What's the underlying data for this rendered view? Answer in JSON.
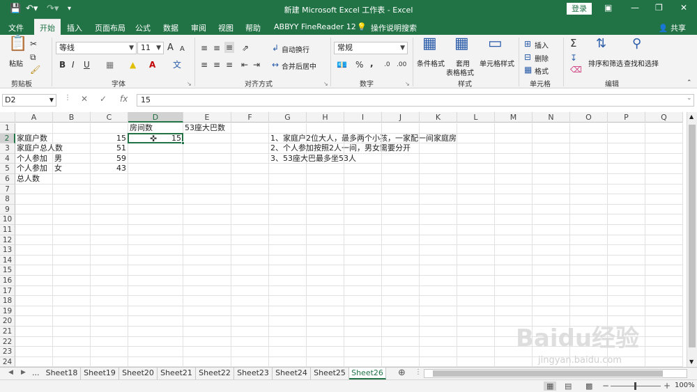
{
  "title": "新建 Microsoft Excel 工作表 - Excel",
  "login_label": "登录",
  "quick_access": {
    "save_icon": "save-icon",
    "undo_icon": "undo-icon",
    "redo_icon": "redo-icon",
    "customize_icon": "customize-icon"
  },
  "tabs": [
    "文件",
    "开始",
    "插入",
    "页面布局",
    "公式",
    "数据",
    "审阅",
    "视图",
    "帮助",
    "ABBYY FineReader 12"
  ],
  "tell_me": "操作说明搜索",
  "share": "共享",
  "ribbon": {
    "clipboard": {
      "paste": "粘贴",
      "group": "剪贴板"
    },
    "font": {
      "name": "等线",
      "size": "11",
      "group": "字体",
      "bold": "B",
      "italic": "I",
      "underline": "U",
      "grow": "A",
      "shrink": "A"
    },
    "alignment": {
      "wrap": "自动换行",
      "merge": "合并后居中",
      "group": "对齐方式"
    },
    "number": {
      "format": "常规",
      "percent": "%",
      "comma": ",",
      "group": "数字"
    },
    "styles": {
      "conditional": "条件格式",
      "table": "套用\n表格格式",
      "cell_styles": "单元格样式",
      "table_line1": "套用",
      "table_line2": "表格格式",
      "group": "样式"
    },
    "cells": {
      "insert": "插入",
      "delete": "删除",
      "format": "格式",
      "group": "单元格"
    },
    "editing": {
      "sort": "排序和筛选",
      "find": "查找和选择",
      "group": "编辑"
    }
  },
  "formula_bar": {
    "name_box": "D2",
    "fx": "fx",
    "value": "15"
  },
  "columns": [
    "A",
    "B",
    "C",
    "D",
    "E",
    "F",
    "G",
    "H",
    "I",
    "J",
    "K",
    "L",
    "M",
    "N",
    "O",
    "P",
    "Q"
  ],
  "rows": [
    "1",
    "2",
    "3",
    "4",
    "5",
    "6",
    "7",
    "8",
    "9",
    "10",
    "11",
    "12",
    "13",
    "14",
    "15",
    "16",
    "17",
    "18",
    "19",
    "20",
    "21",
    "22",
    "23",
    "24"
  ],
  "cells": {
    "D1": "房间数",
    "E1": "53座大巴数",
    "A2": "家庭户数",
    "C2": "15",
    "D2": "15",
    "A3": "家庭户总人数",
    "C3": "51",
    "A4": "个人参加",
    "B4": "男",
    "C4": "59",
    "A5": "个人参加",
    "B5": "女",
    "C5": "43",
    "A6": "总人数",
    "G2": "1、家庭户2位大人，最多两个小孩，一家配一间家庭房",
    "G3": "2、个人参加按照2人一间，男女需要分开",
    "G4": "3、53座大巴最多坐53人"
  },
  "sheets": [
    "Sheet18",
    "Sheet19",
    "Sheet20",
    "Sheet21",
    "Sheet22",
    "Sheet23",
    "Sheet24",
    "Sheet25",
    "Sheet26"
  ],
  "active_sheet": "Sheet26",
  "sheet_nav_more": "...",
  "zoom": "100%",
  "watermark": "Baidu经验",
  "watermark_url": "jingyan.baidu.com",
  "colors": {
    "accent": "#217346",
    "ribbon_bg": "#f3f3f3"
  }
}
